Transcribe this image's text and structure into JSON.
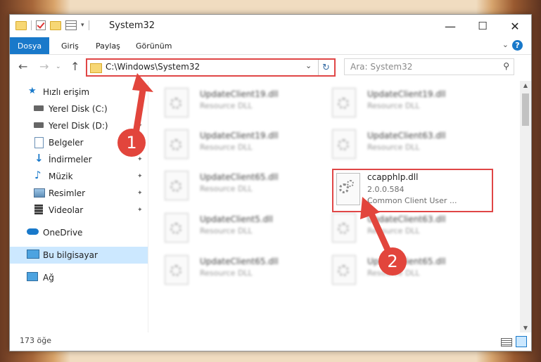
{
  "window": {
    "title": "System32",
    "minimize": "—",
    "maximize": "☐",
    "close": "✕"
  },
  "ribbon": {
    "tabs": [
      "Dosya",
      "Giriş",
      "Paylaş",
      "Görünüm"
    ],
    "help": "?",
    "collapse": "⌄"
  },
  "nav": {
    "back": "←",
    "forward": "→",
    "up": "↑",
    "dropdown": "⌄",
    "refresh": "↻"
  },
  "address": {
    "path": "C:\\Windows\\System32"
  },
  "search": {
    "placeholder": "Ara: System32",
    "icon": "search-icon"
  },
  "sidebar": {
    "items": [
      {
        "label": "Hızlı erişim",
        "icon": "star-icon",
        "pinned": false
      },
      {
        "label": "Yerel Disk (C:)",
        "icon": "drive-icon",
        "pinned": true
      },
      {
        "label": "Yerel Disk (D:)",
        "icon": "drive-icon",
        "pinned": true
      },
      {
        "label": "Belgeler",
        "icon": "documents-icon",
        "pinned": true
      },
      {
        "label": "İndirmeler",
        "icon": "download-icon",
        "pinned": true
      },
      {
        "label": "Müzik",
        "icon": "music-icon",
        "pinned": true
      },
      {
        "label": "Resimler",
        "icon": "pictures-icon",
        "pinned": true
      },
      {
        "label": "Videolar",
        "icon": "videos-icon",
        "pinned": true
      },
      {
        "label": "OneDrive",
        "icon": "cloud-icon",
        "pinned": false
      },
      {
        "label": "Bu bilgisayar",
        "icon": "computer-icon",
        "pinned": false,
        "selected": true
      },
      {
        "label": "Ağ",
        "icon": "network-icon",
        "pinned": false
      }
    ],
    "pin_glyph": "📌"
  },
  "files": [
    {
      "name": "UpdateClient19.dll",
      "desc": "Resource DLL"
    },
    {
      "name": "UpdateClient19.dll",
      "desc": "Resource DLL"
    },
    {
      "name": "UpdateClient19.dll",
      "desc": "Resource DLL"
    },
    {
      "name": "UpdateClient63.dll",
      "desc": "Resource DLL"
    },
    {
      "name": "UpdateClient65.dll",
      "desc": "Resource DLL"
    },
    {
      "name": "UpdateClient5.dll",
      "desc": "Resource DLL"
    },
    {
      "name": "UpdateClient63.dll",
      "desc": "Resource DLL"
    },
    {
      "name": "UpdateClient65.dll",
      "desc": "Resource DLL"
    },
    {
      "name": "UpdateClient65.dll",
      "desc": "Resource DLL"
    }
  ],
  "highlighted_file": {
    "name": "ccapphlp.dll",
    "version": "2.0.0.584",
    "description": "Common Client User ..."
  },
  "status": {
    "count": "173 öğe"
  },
  "annotations": {
    "step1": "1",
    "step2": "2",
    "highlight_color": "#e04646"
  },
  "colors": {
    "accent": "#1979ca",
    "selection": "#cce8ff"
  }
}
